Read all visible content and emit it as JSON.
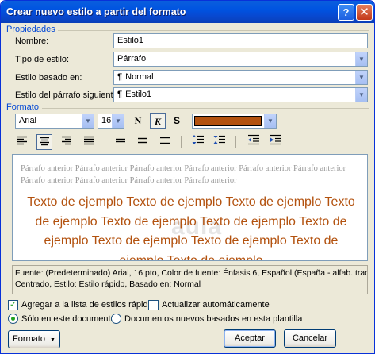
{
  "window": {
    "title": "Crear nuevo estilo a partir del formato"
  },
  "propiedades": {
    "heading": "Propiedades",
    "nombre_label": "Nombre:",
    "nombre_value": "Estilo1",
    "tipo_label": "Tipo de estilo:",
    "tipo_value": "Párrafo",
    "basado_label": "Estilo basado en:",
    "basado_value": "Normal",
    "siguiente_label": "Estilo del párrafo siguiente:",
    "siguiente_value": "Estilo1",
    "paragraph_mark": "¶"
  },
  "formato": {
    "heading": "Formato",
    "font": "Arial",
    "size": "16",
    "bold": "N",
    "italic": "K",
    "underline": "S",
    "font_color": "#b3520f"
  },
  "preview": {
    "previous_paragraph": "Párrafo anterior Párrafo anterior Párrafo anterior Párrafo anterior Párrafo anterior Párrafo anterior Párrafo anterior Párrafo anterior Párrafo anterior Párrafo anterior",
    "sample_text": "Texto de ejemplo Texto de ejemplo Texto de ejemplo Texto de ejemplo Texto de ejemplo Texto de ejemplo Texto de ejemplo Texto de ejemplo Texto de ejemplo Texto de ejemplo Texto de ejemplo",
    "watermark": "aula"
  },
  "description": {
    "line1": "Fuente: (Predeterminado) Arial, 16 pto, Color de fuente: Énfasis 6, Español (España - alfab. tradici",
    "line2": "Centrado, Estilo: Estilo rápido, Basado en: Normal"
  },
  "options": {
    "agregar_label": "Agregar a la lista de estilos rápidos",
    "agregar_checked": true,
    "actualizar_label": "Actualizar automáticamente",
    "actualizar_checked": false,
    "solo_label": "Sólo en este documento",
    "nuevos_label": "Documentos nuevos basados en esta plantilla",
    "selected": "solo"
  },
  "buttons": {
    "formato": "Formato",
    "aceptar": "Aceptar",
    "cancelar": "Cancelar"
  },
  "icons": {
    "help": "?",
    "close": "✕",
    "dropdown": "▼"
  }
}
